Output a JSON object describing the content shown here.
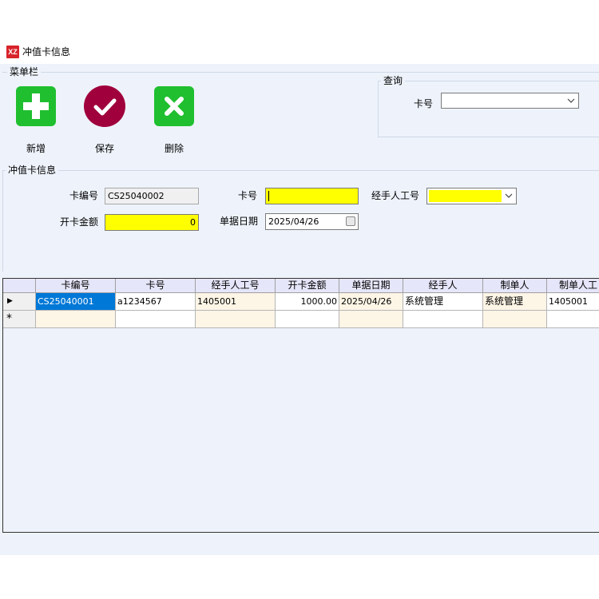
{
  "window": {
    "title": "冲值卡信息",
    "icon_text": "XZ",
    "icon_color": "#d8232a"
  },
  "menu": {
    "title": "菜单栏",
    "buttons": [
      {
        "label": "新增",
        "icon": "plus-icon",
        "color": "#1fbf2f"
      },
      {
        "label": "保存",
        "icon": "check-icon",
        "color": "#a0003c"
      },
      {
        "label": "删除",
        "icon": "cross-icon",
        "color": "#1fbf2f"
      }
    ]
  },
  "query": {
    "title": "查询",
    "card_no_label": "卡号",
    "card_no_value": ""
  },
  "info": {
    "title": "冲值卡信息",
    "card_code_label": "卡编号",
    "card_code_value": "CS25040002",
    "card_no_label": "卡号",
    "card_no_value": "",
    "handler_no_label": "经手人工号",
    "handler_no_value": "",
    "amount_label": "开卡金额",
    "amount_value": "0",
    "date_label": "单据日期",
    "date_value": "2025/04/26"
  },
  "grid": {
    "columns": [
      "卡编号",
      "卡号",
      "经手人工号",
      "开卡金额",
      "单据日期",
      "经手人",
      "制单人",
      "制单人工"
    ],
    "rows": [
      [
        "CS25040001",
        "a1234567",
        "1405001",
        "1000.00",
        "2025/04/26",
        "系统管理",
        "系统管理",
        "1405001"
      ]
    ],
    "new_row_marker": "*",
    "current_row_marker": "▶"
  },
  "colors": {
    "background": "#eef3fb",
    "highlight_field": "#ffff00",
    "selection": "#0078d7",
    "header": "#e6e6fa",
    "alt_column": "#fdf5e6"
  }
}
